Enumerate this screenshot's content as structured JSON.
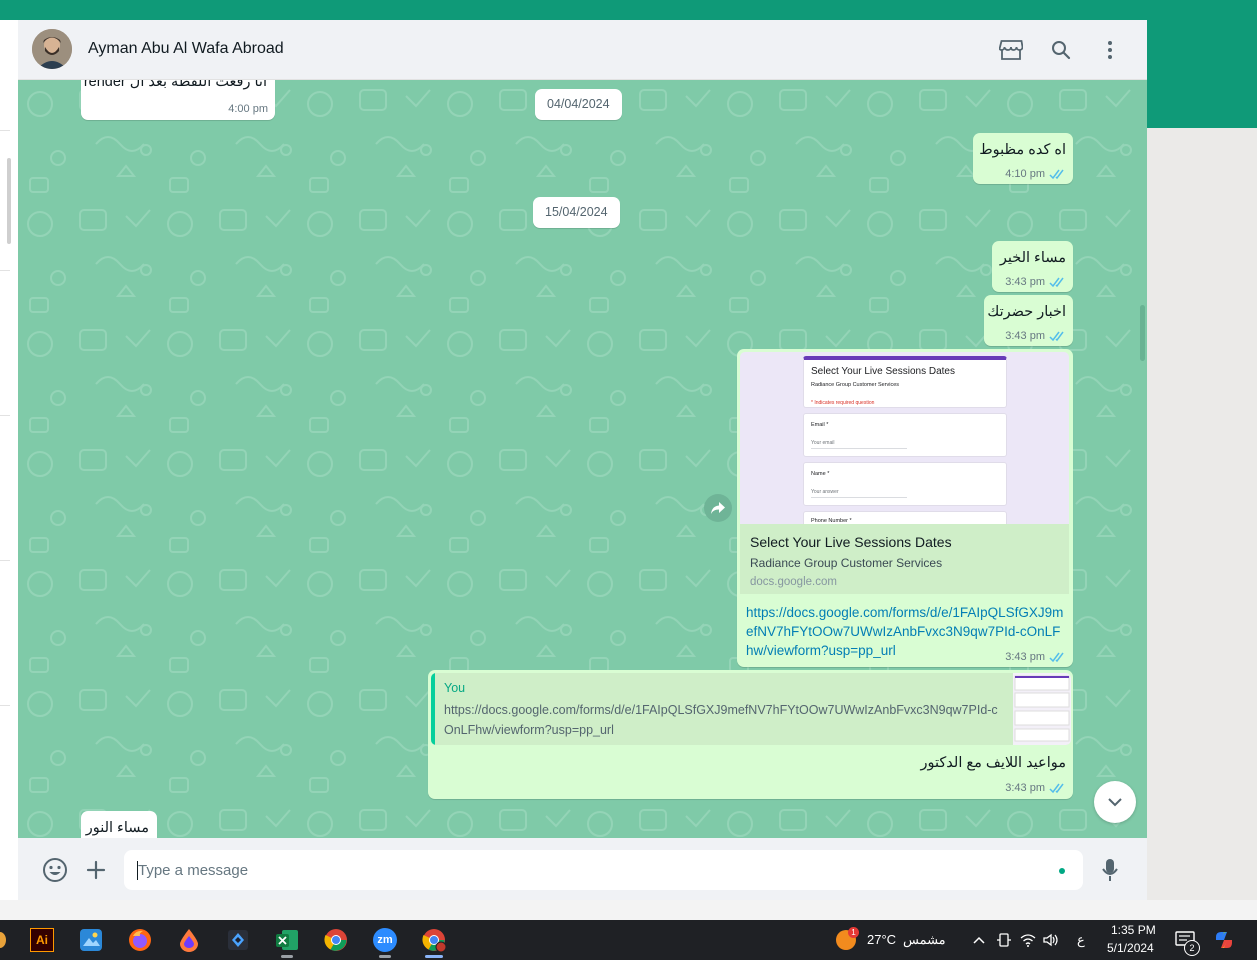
{
  "header": {
    "contact_name": "Ayman Abu Al Wafa Abroad",
    "icons": [
      "store-icon",
      "search-icon",
      "more-vert-icon"
    ]
  },
  "messages": {
    "m0": {
      "text": "انا رفعت اللقطة بعد ال render",
      "time": "4:00 pm"
    },
    "date1": "04/04/2024",
    "m1": {
      "text": "اه كده مظبوط",
      "time": "4:10 pm"
    },
    "date2": "15/04/2024",
    "m2": {
      "text": "مساء الخير",
      "time": "3:43 pm"
    },
    "m3": {
      "text": "اخبار حضرتك",
      "time": "3:43 pm"
    },
    "m4": {
      "preview_form": {
        "title": "Select Your Live Sessions Dates",
        "subtitle": "Radiance Group Customer Services",
        "required": "* Indicates required question",
        "field1": "Email *",
        "field1_hint": "Your email",
        "field2": "Name *",
        "field2_hint": "Your answer",
        "field3": "Phone Number *"
      },
      "card_title": "Select Your Live Sessions Dates",
      "card_desc": "Radiance Group Customer Services",
      "card_domain": "docs.google.com",
      "url": "https://docs.google.com/forms/d/e/1FAIpQLSfGXJ9mefNV7hFYtOOw7UWwIzAnbFvxc3N9qw7PId-cOnLFhw/viewform?usp=pp_url",
      "time": "3:43 pm"
    },
    "m5": {
      "quote_author": "You",
      "quote_text": "https://docs.google.com/forms/d/e/1FAIpQLSfGXJ9mefNV7hFYtOOw7UWwIzAnbFvxc3N9qw7PId-cOnLFhw/viewform?usp=pp_url",
      "text": "مواعيد اللايف مع الدكتور",
      "time": "3:43 pm"
    },
    "m6": {
      "text": "مساء النور"
    }
  },
  "composer": {
    "placeholder": "Type a message",
    "icons": [
      "emoji-icon",
      "plus-icon",
      "mic-icon"
    ]
  },
  "taskbar": {
    "apps": [
      "illustrator-icon",
      "paint-icon",
      "firefox-icon",
      "drop-icon",
      "app-icon",
      "excel-icon",
      "chrome-icon",
      "zoom-icon",
      "chrome-profile-icon"
    ],
    "weather_badge": "1",
    "temperature": "27°C",
    "weather_label": "مشمس",
    "keyboard_lang": "ع",
    "time": "1:35 PM",
    "date": "5/1/2024",
    "notification_count": "2"
  },
  "colors": {
    "accent": "#0f9a78",
    "chat_bg": "#7fcaa8",
    "outgoing_bubble": "#d9fdd3",
    "incoming_bubble": "#ffffff",
    "link": "#027eb5",
    "read_ticks": "#53bdeb"
  }
}
